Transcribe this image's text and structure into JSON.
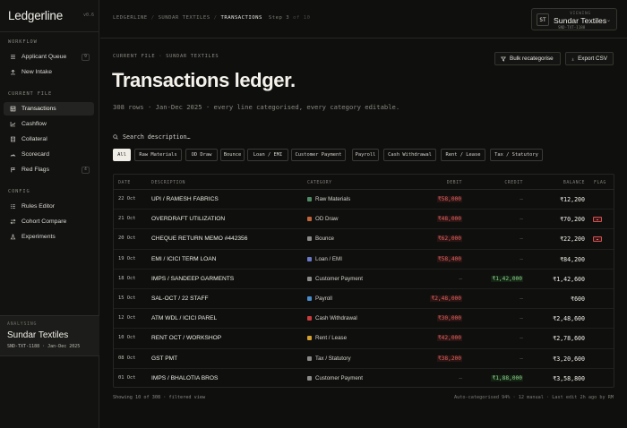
{
  "app": {
    "name": "Ledgerline",
    "version": "v0.6"
  },
  "sidebar": {
    "sections": [
      {
        "label": "WORKFLOW"
      },
      {
        "label": "CURRENT FILE"
      },
      {
        "label": "CONFIG"
      }
    ],
    "items": [
      {
        "label": "Applicant Queue",
        "icon": "inbox-icon",
        "count": "9"
      },
      {
        "label": "New Intake",
        "icon": "upload-icon"
      },
      {
        "label": "Transactions",
        "icon": "table-icon"
      },
      {
        "label": "Cashflow",
        "icon": "chart-icon"
      },
      {
        "label": "Collateral",
        "icon": "document-icon"
      },
      {
        "label": "Scorecard",
        "icon": "score-icon"
      },
      {
        "label": "Red Flags",
        "icon": "flag-icon",
        "count": "4"
      },
      {
        "label": "Rules Editor",
        "icon": "list-icon"
      },
      {
        "label": "Cohort Compare",
        "icon": "compare-icon"
      },
      {
        "label": "Experiments",
        "icon": "flask-icon"
      }
    ],
    "analysing": {
      "label": "ANALYSING",
      "name": "Sundar Textiles",
      "meta": "SND-TXT-1188 · Jan-Dec 2025"
    }
  },
  "topbar": {
    "crumbs": [
      "LEDGERLINE",
      "SUNDAR TEXTILES",
      "TRANSACTIONS"
    ],
    "step": "Step 3",
    "step_of": "of 10",
    "viewing": {
      "initials": "ST",
      "label": "VIEWING",
      "name": "Sundar Textiles",
      "id": "SND-TXT-1188"
    }
  },
  "header": {
    "file_label": "CURRENT FILE · SUNDAR TEXTILES",
    "title": "Transactions ledger.",
    "subtitle": "308 rows · Jan-Dec 2025 · every line categorised, every category editable.",
    "bulk_button": "Bulk recategorise",
    "export_button": "Export CSV"
  },
  "search": {
    "placeholder": "Search description…"
  },
  "filters": [
    "All",
    "Raw Materials",
    "OD Draw",
    "Bounce",
    "Loan / EMI",
    "Customer Payment",
    "Payroll",
    "Cash Withdrawal",
    "Rent / Lease",
    "Tax / Statutory"
  ],
  "table": {
    "columns": [
      "DATE",
      "DESCRIPTION",
      "CATEGORY",
      "DEBIT",
      "CREDIT",
      "BALANCE",
      "FLAG"
    ],
    "rows": [
      {
        "date": "22 Oct",
        "desc": "UPI / RAMESH FABRICS",
        "cat": "Raw Materials",
        "color": "#4e8a64",
        "debit": "₹58,000",
        "credit": "–",
        "balance": "₹12,200",
        "flag": false
      },
      {
        "date": "21 Oct",
        "desc": "OVERDRAFT UTILIZATION",
        "cat": "OD Draw",
        "color": "#c0643a",
        "debit": "₹48,000",
        "credit": "–",
        "balance": "₹70,200",
        "flag": true
      },
      {
        "date": "20 Oct",
        "desc": "CHEQUE RETURN MEMO #442356",
        "cat": "Bounce",
        "color": "#8a8a86",
        "debit": "₹62,000",
        "credit": "–",
        "balance": "₹22,200",
        "flag": true
      },
      {
        "date": "19 Oct",
        "desc": "EMI / ICICI TERM LOAN",
        "cat": "Loan / EMI",
        "color": "#6a78c8",
        "debit": "₹58,400",
        "credit": "–",
        "balance": "₹84,200",
        "flag": false
      },
      {
        "date": "18 Oct",
        "desc": "IMPS / SANDEEP GARMENTS",
        "cat": "Customer Payment",
        "color": "#8a8a86",
        "debit": "–",
        "credit": "₹1,42,000",
        "balance": "₹1,42,600",
        "flag": false
      },
      {
        "date": "15 Oct",
        "desc": "SAL-OCT / 22 STAFF",
        "cat": "Payroll",
        "color": "#4a8ccc",
        "debit": "₹2,48,000",
        "credit": "–",
        "balance": "₹600",
        "flag": false
      },
      {
        "date": "12 Oct",
        "desc": "ATM WDL / ICICI PAREL",
        "cat": "Cash Withdrawal",
        "color": "#c83c3c",
        "debit": "₹30,000",
        "credit": "–",
        "balance": "₹2,48,600",
        "flag": false
      },
      {
        "date": "10 Oct",
        "desc": "RENT OCT / WORKSHOP",
        "cat": "Rent / Lease",
        "color": "#d4a030",
        "debit": "₹42,000",
        "credit": "–",
        "balance": "₹2,78,600",
        "flag": false
      },
      {
        "date": "08 Oct",
        "desc": "GST PMT",
        "cat": "Tax / Statutory",
        "color": "#8a8a86",
        "debit": "₹38,200",
        "credit": "–",
        "balance": "₹3,20,600",
        "flag": false
      },
      {
        "date": "01 Oct",
        "desc": "IMPS / BHALOTIA BROS",
        "cat": "Customer Payment",
        "color": "#8a8a86",
        "debit": "–",
        "credit": "₹1,88,000",
        "balance": "₹3,58,800",
        "flag": false
      }
    ]
  },
  "footer": {
    "left": "Showing 10 of 308 · filtered view",
    "right": "Auto-categorised 94% · 12 manual · Last edit 2h ago by RM"
  }
}
